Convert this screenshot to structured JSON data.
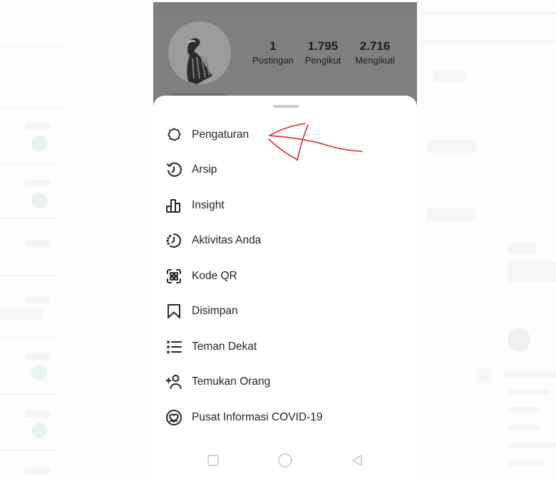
{
  "profile": {
    "stats": [
      {
        "value": "1",
        "label": "Postingan"
      },
      {
        "value": "1.795",
        "label": "Pengikut"
      },
      {
        "value": "2.716",
        "label": "Mengikuti"
      }
    ]
  },
  "menu": {
    "items": [
      {
        "label": "Pengaturan",
        "icon": "settings-gear-icon"
      },
      {
        "label": "Arsip",
        "icon": "archive-history-icon"
      },
      {
        "label": "Insight",
        "icon": "insights-bar-chart-icon"
      },
      {
        "label": "Aktivitas Anda",
        "icon": "activity-clock-icon"
      },
      {
        "label": "Kode QR",
        "icon": "qr-code-icon"
      },
      {
        "label": "Disimpan",
        "icon": "bookmark-icon"
      },
      {
        "label": "Teman Dekat",
        "icon": "close-friends-list-icon"
      },
      {
        "label": "Temukan Orang",
        "icon": "discover-people-icon"
      },
      {
        "label": "Pusat Informasi COVID-19",
        "icon": "covid-info-heart-icon"
      }
    ]
  },
  "navbar": {
    "buttons": [
      "recent-apps",
      "home",
      "back"
    ]
  },
  "annotation": {
    "color": "#e0282f",
    "points_to": "Pengaturan"
  }
}
